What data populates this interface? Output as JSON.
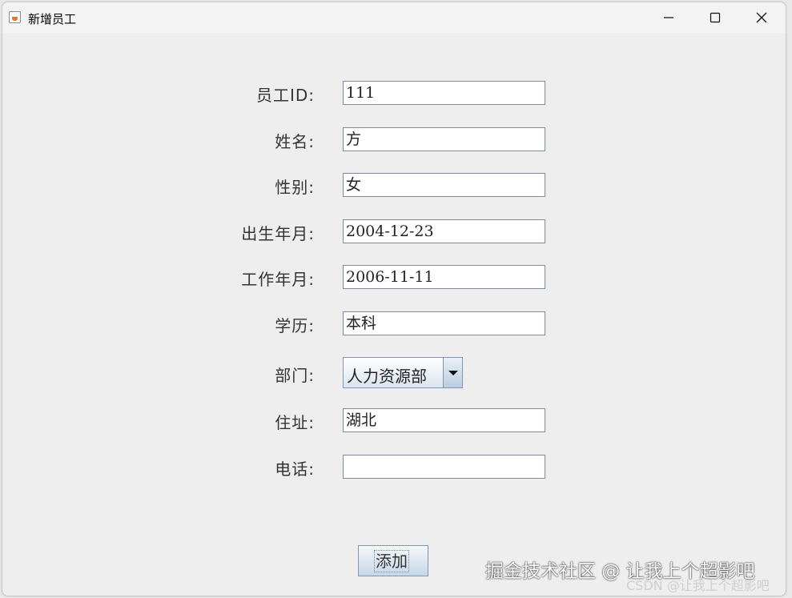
{
  "window": {
    "title": "新增员工",
    "icon": "java-app-icon",
    "controls": [
      "minimize-icon",
      "maximize-icon",
      "close-icon"
    ]
  },
  "form": {
    "fields": [
      {
        "label": "员工ID:",
        "value": "111"
      },
      {
        "label": "姓名:",
        "value": "方"
      },
      {
        "label": "性别:",
        "value": "女"
      },
      {
        "label": "出生年月:",
        "value": "2004-12-23"
      },
      {
        "label": "工作年月:",
        "value": "2006-11-11"
      },
      {
        "label": "学历:",
        "value": "本科"
      }
    ],
    "department": {
      "label": "部门:",
      "selected": "人力资源部"
    },
    "address": {
      "label": "住址:",
      "value": "湖北"
    },
    "phone": {
      "label": "电话:",
      "value": ""
    }
  },
  "actions": {
    "add_label": "添加"
  },
  "watermark": {
    "text": "掘金技术社区 @ 让我上个超影吧",
    "sub": "CSDN @让我上个超影吧"
  }
}
